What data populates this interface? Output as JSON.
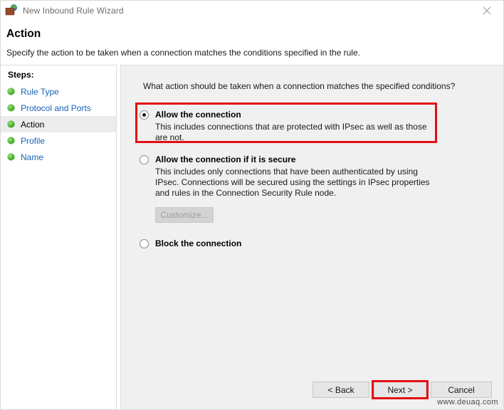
{
  "window": {
    "title": "New Inbound Rule Wizard",
    "icon": "firewall-brickwall-globe-icon",
    "close_label": "close-icon"
  },
  "header": {
    "title": "Action",
    "subtitle": "Specify the action to be taken when a connection matches the conditions specified in the rule."
  },
  "sidebar": {
    "label": "Steps:",
    "items": [
      {
        "label": "Rule Type",
        "current": false
      },
      {
        "label": "Protocol and Ports",
        "current": false
      },
      {
        "label": "Action",
        "current": true
      },
      {
        "label": "Profile",
        "current": false
      },
      {
        "label": "Name",
        "current": false
      }
    ]
  },
  "main": {
    "question": "What action should be taken when a connection matches the specified conditions?",
    "options": [
      {
        "title": "Allow the connection",
        "description": "This includes connections that are protected with IPsec as well as those are not.",
        "selected": true
      },
      {
        "title": "Allow the connection if it is secure",
        "description": "This includes only connections that have been authenticated by using IPsec.  Connections will be secured using the settings in IPsec properties and rules in the Connection Security Rule node.",
        "selected": false,
        "customize_label": "Customize..."
      },
      {
        "title": "Block the connection",
        "description": "",
        "selected": false
      }
    ]
  },
  "footer": {
    "back_label": "< Back",
    "next_label": "Next >",
    "cancel_label": "Cancel"
  },
  "watermark": "www.deuaq.com",
  "colors": {
    "annotation_red": "#e40d14",
    "link_blue": "#1763b8",
    "content_bg": "#f0f0f0",
    "step_bullet_green": "#57c236"
  }
}
